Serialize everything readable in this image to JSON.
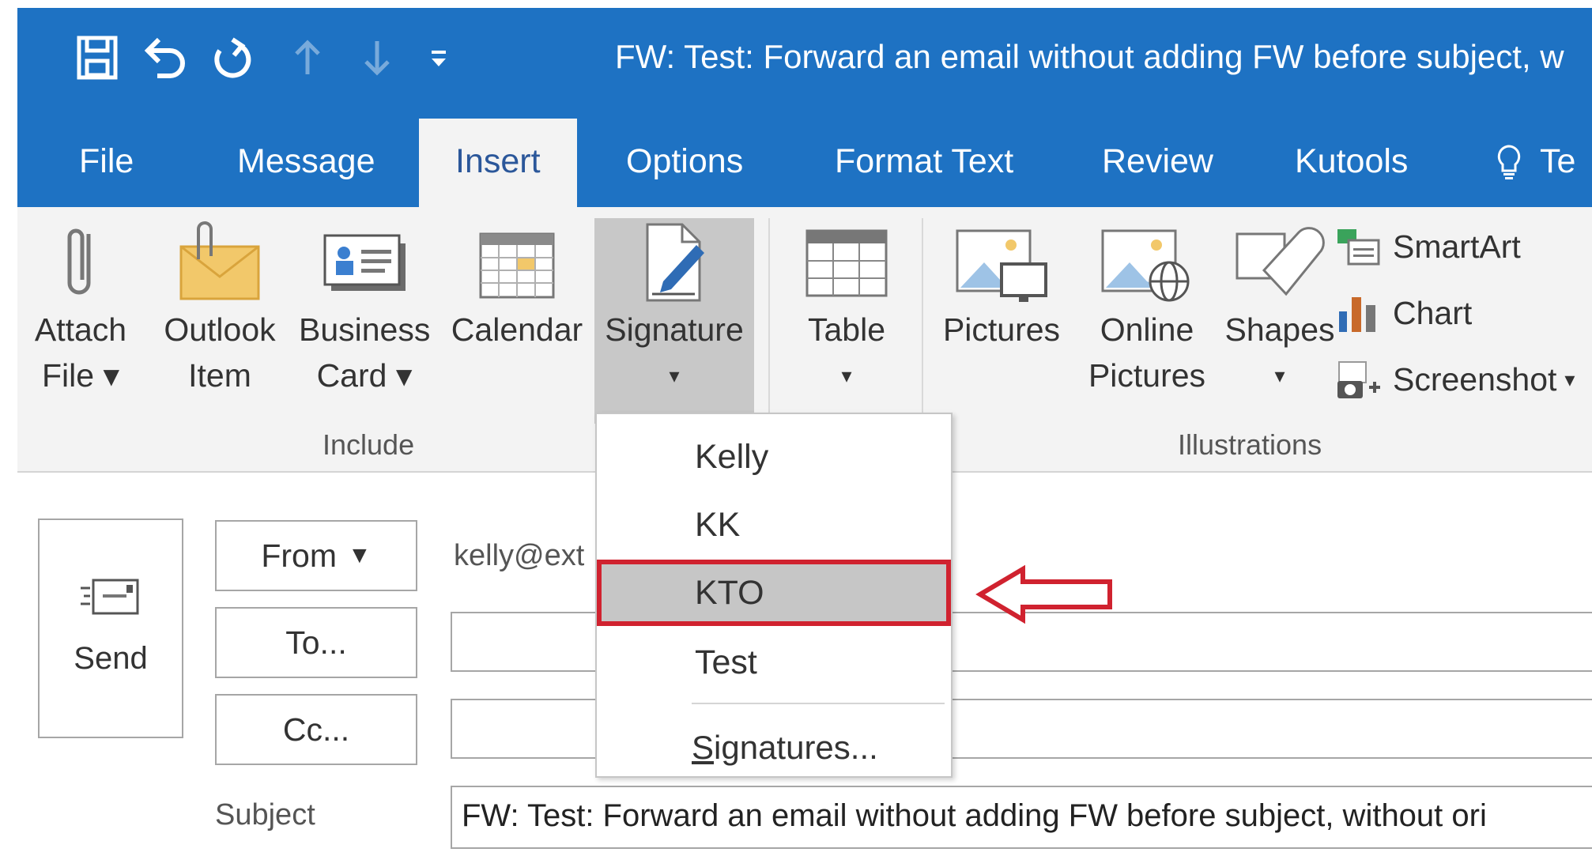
{
  "window": {
    "title": "FW: Test: Forward an email without adding FW before subject, w",
    "accent_color": "#1e72c3"
  },
  "quick_access": {
    "save_icon": "save-icon",
    "undo_icon": "undo-icon",
    "redo_icon": "redo-icon",
    "up_icon": "arrow-up-icon",
    "down_icon": "arrow-down-icon",
    "customize_icon": "customize-qat-icon"
  },
  "tabs": [
    {
      "label": "File"
    },
    {
      "label": "Message"
    },
    {
      "label": "Insert",
      "active": true
    },
    {
      "label": "Options"
    },
    {
      "label": "Format Text"
    },
    {
      "label": "Review"
    },
    {
      "label": "Kutools"
    },
    {
      "label": "Te"
    }
  ],
  "ribbon": {
    "include_group": {
      "label": "Include",
      "buttons": [
        {
          "line1": "Attach",
          "line2": "File",
          "icon": "paperclip-icon"
        },
        {
          "line1": "Outlook",
          "line2": "Item",
          "icon": "envelope-icon"
        },
        {
          "line1": "Business",
          "line2": "Card",
          "icon": "business-card-icon"
        },
        {
          "line1": "Calendar",
          "line2": "",
          "icon": "calendar-icon"
        },
        {
          "line1": "Signature",
          "line2": "",
          "icon": "signature-icon"
        }
      ]
    },
    "tables_group": {
      "buttons": [
        {
          "line1": "Table",
          "icon": "table-icon"
        }
      ]
    },
    "illustrations_group": {
      "label": "Illustrations",
      "buttons": [
        {
          "line1": "Pictures",
          "line2": "",
          "icon": "pictures-icon"
        },
        {
          "line1": "Online",
          "line2": "Pictures",
          "icon": "online-pictures-icon"
        },
        {
          "line1": "Shapes",
          "line2": "",
          "icon": "shapes-icon"
        }
      ],
      "small_buttons": [
        {
          "label": "SmartArt",
          "icon": "smartart-icon"
        },
        {
          "label": "Chart",
          "icon": "chart-icon"
        },
        {
          "label": "Screenshot",
          "icon": "screenshot-icon"
        }
      ]
    }
  },
  "compose": {
    "send_label": "Send",
    "from_label": "From",
    "from_value": "kelly@ext",
    "to_label": "To...",
    "cc_label": "Cc...",
    "subject_label": "Subject",
    "subject_value": "FW: Test: Forward an email without adding FW before subject, without ori"
  },
  "signature_menu": {
    "items": [
      {
        "label": "Kelly"
      },
      {
        "label": "KK"
      },
      {
        "label": "KTO",
        "highlighted": true
      },
      {
        "label": "Test"
      }
    ],
    "footer_first": "S",
    "footer_rest": "ignatures...",
    "highlight_color": "#d0222f"
  }
}
